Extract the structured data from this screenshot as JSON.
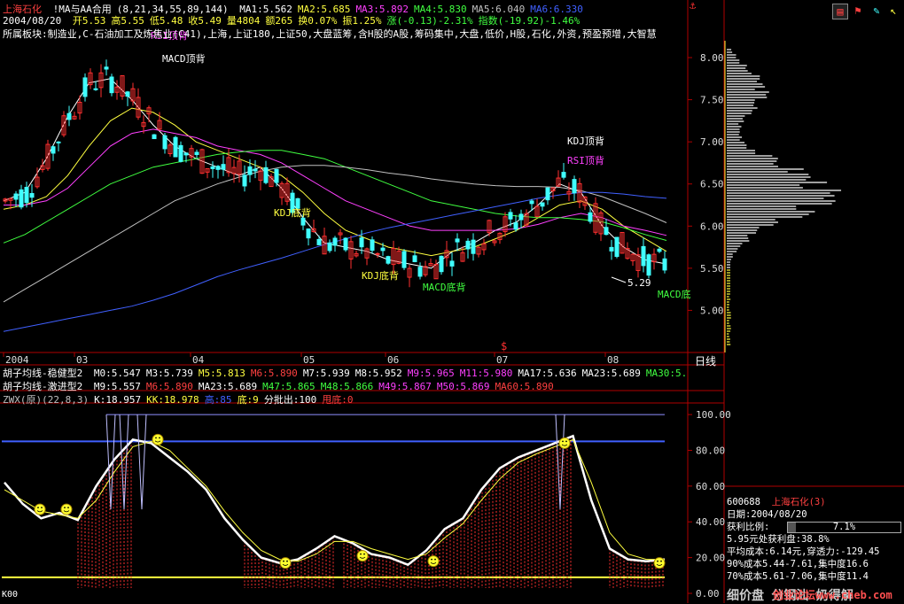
{
  "header": {
    "stock_name": "上海石化",
    "indicator": "!MA与AA合用",
    "params": "(8,21,34,55,89,144)",
    "ma": [
      {
        "label": "MA1:5.562",
        "color": "#ffffff"
      },
      {
        "label": "MA2:5.685",
        "color": "#ffff40"
      },
      {
        "label": "MA3:5.892",
        "color": "#ff40ff"
      },
      {
        "label": "MA4:5.830",
        "color": "#40ff40"
      },
      {
        "label": "MA5:6.040",
        "color": "#c0c0c0"
      },
      {
        "label": "MA6:6.330",
        "color": "#4060ff"
      }
    ],
    "date": "2004/08/20",
    "quote": [
      {
        "label": "开5.53",
        "color": "#ffff40"
      },
      {
        "label": "高5.55",
        "color": "#ffff40"
      },
      {
        "label": "低5.48",
        "color": "#ffff40"
      },
      {
        "label": "收5.49",
        "color": "#ffff40"
      },
      {
        "label": "量4804",
        "color": "#ffff40"
      },
      {
        "label": "额265",
        "color": "#ffff40"
      },
      {
        "label": "换0.07%",
        "color": "#ffff40"
      },
      {
        "label": "振1.25%",
        "color": "#ffff40"
      },
      {
        "label": "涨(-0.13)-2.31%",
        "color": "#40ff40"
      },
      {
        "label": "指数(-19.92)-1.46%",
        "color": "#40ff40"
      }
    ],
    "sector": "所属板块:制造业,C-石油加工及炼焦业(C41),上海,上证180,上证50,大盘蓝筹,含H股的A股,筹码集中,大盘,低价,H股,石化,外资,预盈预增,大智慧"
  },
  "toolbar": {
    "icons": [
      "grid-icon",
      "flag-icon",
      "tools-icon",
      "pointer-icon"
    ]
  },
  "chart_data": [
    {
      "type": "candlestick",
      "title": "上海石化 日线",
      "x_ticks": [
        "2004",
        "03",
        "04",
        "05",
        "06",
        "07",
        "08"
      ],
      "x_axis_label": "日线",
      "ylim": [
        4.5,
        8.2
      ],
      "y_ticks": [
        8.0,
        7.5,
        7.0,
        6.5,
        6.0,
        5.5,
        5.0
      ],
      "y_tick_labels": [
        "8.00",
        "7.50",
        "7.00",
        "6.50",
        "6.00",
        "5.50",
        "5.00"
      ],
      "last": {
        "open": 5.53,
        "high": 5.55,
        "low": 5.48,
        "close": 5.49
      },
      "low_marker": "5.29",
      "annotations": [
        {
          "text": "MACD顶背",
          "color": "#ffffff"
        },
        {
          "text": "RSI顶背",
          "color": "#ff40ff"
        },
        {
          "text": "KDJ底背",
          "color": "#ffff40"
        },
        {
          "text": "KDJ底背",
          "color": "#ffff40"
        },
        {
          "text": "MACD底背",
          "color": "#40ff40"
        },
        {
          "text": "KDJ顶背",
          "color": "#ffffff"
        },
        {
          "text": "RSI顶背",
          "color": "#ff40ff"
        },
        {
          "text": "MACD底",
          "color": "#40ff40"
        }
      ],
      "series": [
        {
          "name": "MA1",
          "color": "#ffffff",
          "values": [
            6.3,
            6.4,
            6.8,
            7.3,
            7.7,
            7.75,
            7.5,
            7.2,
            6.95,
            6.8,
            6.7,
            6.6,
            6.7,
            6.45,
            6.1,
            5.8,
            5.75,
            5.7,
            5.6,
            5.55,
            5.5,
            5.7,
            5.8,
            5.95,
            6.05,
            6.25,
            6.5,
            6.4,
            6.0,
            5.75,
            5.6,
            5.55
          ]
        },
        {
          "name": "MA2",
          "color": "#ffff40",
          "values": [
            6.2,
            6.25,
            6.35,
            6.6,
            6.95,
            7.25,
            7.4,
            7.35,
            7.2,
            7.0,
            6.9,
            6.8,
            6.7,
            6.6,
            6.4,
            6.15,
            5.95,
            5.85,
            5.75,
            5.7,
            5.65,
            5.7,
            5.75,
            5.85,
            5.95,
            6.1,
            6.25,
            6.3,
            6.2,
            6.0,
            5.85,
            5.7
          ]
        },
        {
          "name": "MA3",
          "color": "#ff40ff",
          "values": [
            6.25,
            6.25,
            6.3,
            6.45,
            6.7,
            6.95,
            7.1,
            7.15,
            7.1,
            7.05,
            6.95,
            6.9,
            6.85,
            6.75,
            6.6,
            6.45,
            6.3,
            6.2,
            6.1,
            6.0,
            5.95,
            5.95,
            5.95,
            5.95,
            5.97,
            6.02,
            6.1,
            6.15,
            6.1,
            6.0,
            5.95,
            5.89
          ]
        },
        {
          "name": "MA4",
          "color": "#40ff40",
          "values": [
            5.8,
            5.9,
            6.05,
            6.2,
            6.35,
            6.5,
            6.6,
            6.7,
            6.75,
            6.8,
            6.85,
            6.88,
            6.9,
            6.9,
            6.85,
            6.8,
            6.7,
            6.6,
            6.5,
            6.4,
            6.3,
            6.25,
            6.2,
            6.15,
            6.12,
            6.1,
            6.1,
            6.08,
            6.05,
            5.98,
            5.9,
            5.83
          ]
        },
        {
          "name": "MA5",
          "color": "#c0c0c0",
          "values": [
            5.1,
            5.25,
            5.4,
            5.55,
            5.7,
            5.85,
            6.0,
            6.15,
            6.3,
            6.4,
            6.5,
            6.58,
            6.65,
            6.7,
            6.72,
            6.72,
            6.7,
            6.67,
            6.63,
            6.6,
            6.56,
            6.53,
            6.5,
            6.48,
            6.47,
            6.47,
            6.46,
            6.42,
            6.35,
            6.25,
            6.15,
            6.04
          ]
        },
        {
          "name": "MA6",
          "color": "#4060ff",
          "values": [
            4.75,
            4.8,
            4.85,
            4.9,
            4.95,
            5.0,
            5.05,
            5.12,
            5.2,
            5.3,
            5.4,
            5.48,
            5.55,
            5.62,
            5.7,
            5.78,
            5.85,
            5.92,
            5.98,
            6.03,
            6.08,
            6.13,
            6.18,
            6.23,
            6.28,
            6.33,
            6.37,
            6.4,
            6.4,
            6.38,
            6.35,
            6.33
          ]
        }
      ]
    },
    {
      "type": "line",
      "title": "ZWX(原)(22,8,3)",
      "legend": [
        {
          "label": "ZWX(原)(22,8,3)",
          "color": "#c0c0c0"
        },
        {
          "label": "K:18.957",
          "color": "#ffffff"
        },
        {
          "label": "KK:18.978",
          "color": "#ffff40"
        },
        {
          "label": "高:85",
          "color": "#4060ff"
        },
        {
          "label": "底:9",
          "color": "#ffff40"
        },
        {
          "label": "分批出:100",
          "color": "#ffffff"
        },
        {
          "label": "甩底:0",
          "color": "#ff4040"
        }
      ],
      "ylim": [
        0,
        105
      ],
      "y_ticks": [
        100,
        80,
        60,
        40,
        20,
        0
      ],
      "y_tick_labels": [
        "100.00",
        "80.00",
        "60.00",
        "40.00",
        "20.00",
        "0.00"
      ],
      "hlines": [
        {
          "name": "高",
          "value": 85,
          "color": "#4060ff"
        },
        {
          "name": "底",
          "value": 9,
          "color": "#ffff40"
        }
      ],
      "series": [
        {
          "name": "K",
          "color": "#ffffff",
          "values": [
            62,
            50,
            42,
            45,
            41,
            60,
            75,
            86,
            84,
            76,
            68,
            58,
            42,
            30,
            20,
            17,
            19,
            25,
            32,
            28,
            22,
            20,
            16,
            24,
            36,
            42,
            58,
            70,
            76,
            80,
            84,
            88,
            52,
            25,
            19,
            18,
            19
          ]
        },
        {
          "name": "KK",
          "color": "#ffff40",
          "values": [
            58,
            52,
            46,
            44,
            42,
            52,
            68,
            82,
            85,
            80,
            70,
            60,
            46,
            34,
            24,
            19,
            18,
            22,
            29,
            29,
            25,
            22,
            19,
            22,
            31,
            39,
            52,
            64,
            73,
            78,
            82,
            86,
            62,
            34,
            22,
            19,
            19
          ]
        }
      ]
    }
  ],
  "ma_lines": {
    "line1_title": "胡子均线-稳健型2",
    "line1": [
      {
        "label": "M0:5.547",
        "color": "#ffffff"
      },
      {
        "label": "M3:5.739",
        "color": "#ffffff"
      },
      {
        "label": "M5:5.813",
        "color": "#ffff40"
      },
      {
        "label": "M6:5.890",
        "color": "#ff4040"
      },
      {
        "label": "M7:5.939",
        "color": "#ffffff"
      },
      {
        "label": "M8:5.952",
        "color": "#ffffff"
      },
      {
        "label": "M9:5.965",
        "color": "#ff40ff"
      },
      {
        "label": "M11:5.980",
        "color": "#ff40ff"
      },
      {
        "label": "MA17:5.636",
        "color": "#ffffff"
      },
      {
        "label": "MA23:5.689",
        "color": "#ffffff"
      },
      {
        "label": "MA30:5.",
        "color": "#40ff40"
      }
    ],
    "line2_title": "胡子均线-激进型2",
    "line2": [
      {
        "label": "M9:5.557",
        "color": "#ffffff"
      },
      {
        "label": "M6:5.890",
        "color": "#ff4040"
      },
      {
        "label": "MA23:5.689",
        "color": "#ffffff"
      },
      {
        "label": "M47:5.865",
        "color": "#40ff40"
      },
      {
        "label": "M48:5.866",
        "color": "#40ff40"
      },
      {
        "label": "M49:5.867",
        "color": "#ff40ff"
      },
      {
        "label": "M50:5.869",
        "color": "#ff40ff"
      },
      {
        "label": "MA60:5.890",
        "color": "#ff4040"
      }
    ]
  },
  "right_panel": {
    "code": "600688",
    "name": "上海石化(3)",
    "date": "日期:2004/08/20",
    "profit_ratio_label": "获利比例:",
    "profit_ratio": "7.1%",
    "profit_ratio_value": 7.1,
    "line1": "5.95元处获利盘:38.8%",
    "line2": "平均成本:6.14元,穿透力:-129.45",
    "line3": "90%成本5.44-7.61,集中度16.6",
    "line4": "70%成本5.61-7.06,集中度11.4",
    "footer": "细价盘 分钢汕 奶得解",
    "site": "创业论坛www.cheb.com"
  },
  "bottom_left": "K00"
}
